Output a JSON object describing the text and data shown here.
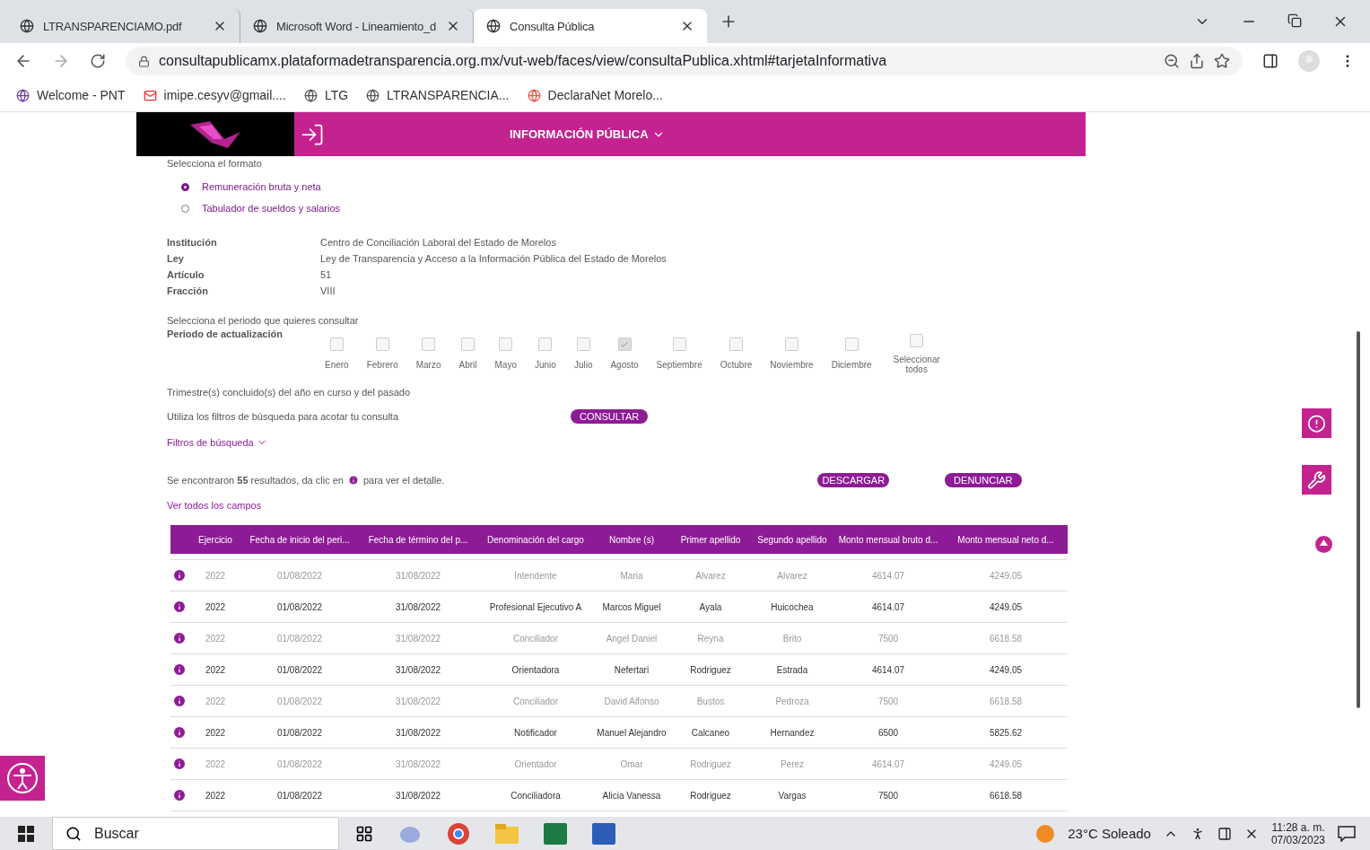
{
  "browser": {
    "tabs": [
      {
        "title": "LTRANSPARENCIAMO.pdf",
        "selected": false
      },
      {
        "title": "Microsoft Word - Lineamiento_d",
        "selected": false
      },
      {
        "title": "Consulta Pública",
        "selected": true
      }
    ],
    "url": "consultapublicamx.plataformadetransparencia.org.mx/vut-web/faces/view/consultaPublica.xhtml#tarjetaInformativa",
    "bookmarks": [
      "Welcome - PNT",
      "imipe.cesyv@gmail....",
      "LTG",
      "LTRANSPARENCIA...",
      "DeclaraNet Morelo..."
    ]
  },
  "header": {
    "menu_label": "INFORMACIÓN PÚBLICA"
  },
  "format": {
    "label": "Selecciona el formato",
    "options": [
      {
        "label": "Remuneración bruta y neta",
        "selected": true
      },
      {
        "label": "Tabulador de sueldos y salarios",
        "selected": false
      }
    ]
  },
  "info": [
    {
      "label": "Institución",
      "value": "Centro de Conciliación Laboral del Estado de Morelos"
    },
    {
      "label": "Ley",
      "value": "Ley de Transparencia y Acceso a la Información Pública del Estado de Morelos"
    },
    {
      "label": "Artículo",
      "value": "51"
    },
    {
      "label": "Fracción",
      "value": "VIII"
    }
  ],
  "period": {
    "prompt": "Selecciona el periodo que quieres consultar",
    "label": "Periodo de actualización",
    "months": [
      {
        "label": "Enero",
        "checked": false
      },
      {
        "label": "Febrero",
        "checked": false
      },
      {
        "label": "Marzo",
        "checked": false
      },
      {
        "label": "Abril",
        "checked": false
      },
      {
        "label": "Mayo",
        "checked": false
      },
      {
        "label": "Junio",
        "checked": false
      },
      {
        "label": "Julio",
        "checked": false
      },
      {
        "label": "Agosto",
        "checked": true
      },
      {
        "label": "Septiembre",
        "checked": false
      },
      {
        "label": "Octubre",
        "checked": false
      },
      {
        "label": "Noviembre",
        "checked": false
      },
      {
        "label": "Diciembre",
        "checked": false
      }
    ],
    "select_all": {
      "label": "Seleccionar todos",
      "checked": false
    }
  },
  "quarter_note": "Trimestre(s) concluido(s) del año en curso y del pasado",
  "filter_hint": "Utiliza los filtros de búsqueda para acotar tu consulta",
  "consult_button": "CONSULTAR",
  "filters_link": "Filtros de búsqueda",
  "results": {
    "before": "Se encontraron **55** resultados, da clic en",
    "after": "para ver el detalle."
  },
  "download_button": "DESCARGAR",
  "denounce_button": "DENUNCIAR",
  "view_all_link": "Ver todos los campos",
  "table": {
    "columns": [
      "Ejercicio",
      "Fecha de inicio del peri...",
      "Fecha de término del p...",
      "Denominación del cargo",
      "Nombre (s)",
      "Primer apellido",
      "Segundo apellido",
      "Monto mensual bruto d...",
      "Monto mensual neto d..."
    ],
    "rows": [
      [
        "2022",
        "01/08/2022",
        "31/08/2022",
        "Intendente",
        "Maria",
        "Alvarez",
        "Alvarez",
        "4614.07",
        "4249.05"
      ],
      [
        "2022",
        "01/08/2022",
        "31/08/2022",
        "Profesional Ejecutivo A",
        "Marcos Miguel",
        "Ayala",
        "Huicochea",
        "4614.07",
        "4249.05"
      ],
      [
        "2022",
        "01/08/2022",
        "31/08/2022",
        "Conciliador",
        "Angel Daniel",
        "Reyna",
        "Brito",
        "7500",
        "6618.58"
      ],
      [
        "2022",
        "01/08/2022",
        "31/08/2022",
        "Orientadora",
        "Nefertari",
        "Rodriguez",
        "Estrada",
        "4614.07",
        "4249.05"
      ],
      [
        "2022",
        "01/08/2022",
        "31/08/2022",
        "Conciliador",
        "David Alfonso",
        "Bustos",
        "Pedroza",
        "7500",
        "6618.58"
      ],
      [
        "2022",
        "01/08/2022",
        "31/08/2022",
        "Notificador",
        "Manuel Alejandro",
        "Calcaneo",
        "Hernandez",
        "6500",
        "5825.62"
      ],
      [
        "2022",
        "01/08/2022",
        "31/08/2022",
        "Orientador",
        "Omar",
        "Rodriguez",
        "Perez",
        "4614.07",
        "4249.05"
      ],
      [
        "2022",
        "01/08/2022",
        "31/08/2022",
        "Conciliadora",
        "Alicia Vanessa",
        "Rodriguez",
        "Vargas",
        "7500",
        "6618.58"
      ]
    ]
  },
  "taskbar": {
    "search_placeholder": "Buscar",
    "weather": "23°C  Soleado",
    "time": "11:28 a. m.",
    "date": "07/03/2023"
  }
}
